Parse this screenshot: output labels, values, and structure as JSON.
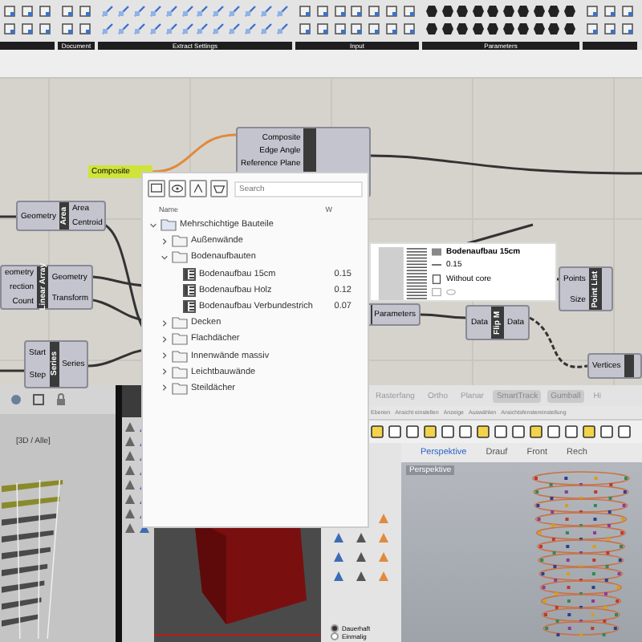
{
  "ribbon": {
    "groups": [
      {
        "label": "Document"
      },
      {
        "label": "Extract Settings"
      },
      {
        "label": "Input"
      },
      {
        "label": "Parameters"
      }
    ]
  },
  "canvas": {
    "panel": {
      "text": "Composite"
    },
    "components": [
      {
        "inputs": [
          "Composite",
          "Edge Angle",
          "Reference Plane"
        ]
      },
      {
        "title": "Area",
        "inputs": [
          "Geometry"
        ],
        "outputs": [
          "Area",
          "Centroid"
        ]
      },
      {
        "title": "Linear Array",
        "inputs": [
          "eometry",
          "rection",
          "Count"
        ],
        "outputs": [
          "Geometry",
          "Transform"
        ]
      },
      {
        "title": "Series",
        "inputs": [
          "Start",
          "Step"
        ],
        "outputs": [
          "Series"
        ]
      },
      {
        "outputs": [
          "Parameters"
        ]
      },
      {
        "title": "Flip M",
        "inputs": [
          "Data"
        ],
        "outputs": [
          "Data"
        ]
      },
      {
        "title": "Point List",
        "inputs": [
          "Points",
          "Size"
        ]
      },
      {
        "inputs": [
          "Vertices"
        ]
      }
    ]
  },
  "popup": {
    "search": {
      "placeholder": "Search"
    },
    "columns": [
      "Name",
      "W"
    ],
    "tree": [
      {
        "kind": "library",
        "label": "Mehrschichtige Bauteile",
        "expanded": true,
        "children": [
          {
            "kind": "folder",
            "label": "Außenwände",
            "expanded": false
          },
          {
            "kind": "folder",
            "label": "Bodenaufbauten",
            "expanded": true,
            "children": [
              {
                "kind": "material",
                "label": "Bodenaufbau 15cm",
                "w": "0.15"
              },
              {
                "kind": "material",
                "label": "Bodenaufbau Holz",
                "w": "0.12"
              },
              {
                "kind": "material",
                "label": "Bodenaufbau Verbundestrich",
                "w": "0.07"
              }
            ]
          },
          {
            "kind": "folder",
            "label": "Decken",
            "expanded": false
          },
          {
            "kind": "folder",
            "label": "Flachdächer",
            "expanded": false
          },
          {
            "kind": "folder",
            "label": "Innenwände massiv",
            "expanded": false
          },
          {
            "kind": "folder",
            "label": "Leichtbauwände",
            "expanded": false
          },
          {
            "kind": "folder",
            "label": "Steildächer",
            "expanded": false
          }
        ]
      }
    ]
  },
  "tooltip": {
    "title": "Bodenaufbau 15cm",
    "thickness": "0.15",
    "core": "Without core"
  },
  "rhino": {
    "left_viewport": {
      "label": "[3D / Alle]"
    },
    "status_bar": [
      {
        "label": "Rasterfang",
        "on": false
      },
      {
        "label": "Ortho",
        "on": false
      },
      {
        "label": "Planar",
        "on": false
      },
      {
        "label": "SmartTrack",
        "on": true
      },
      {
        "label": "Gumball",
        "on": true
      },
      {
        "label": "Hi",
        "on": false
      }
    ],
    "toolbar_tabs": [
      "Ebenen",
      "Ansicht einstellen",
      "Anzeige",
      "Auswählen",
      "Ansichtsfenstereinstellung"
    ],
    "viewport_tabs": [
      {
        "label": "Perspektive",
        "selected": true
      },
      {
        "label": "Drauf",
        "selected": false
      },
      {
        "label": "Front",
        "selected": false
      },
      {
        "label": "Rech",
        "selected": false
      }
    ],
    "viewport": {
      "label": "Perspektive"
    },
    "options": [
      {
        "label": "Dauerhaft",
        "selected": true
      },
      {
        "label": "Einmalig",
        "selected": false
      }
    ]
  }
}
